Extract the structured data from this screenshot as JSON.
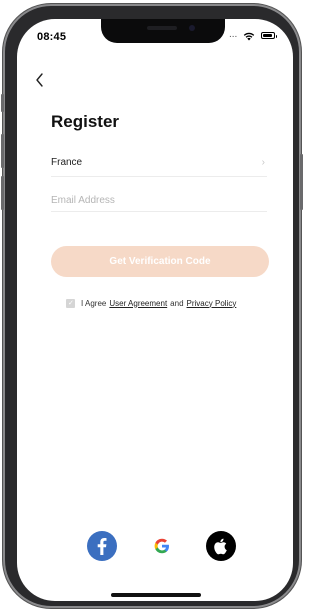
{
  "status_bar": {
    "time": "08:45",
    "signal_text": "...",
    "wifi_icon": "wifi-icon",
    "battery_icon": "battery-icon"
  },
  "nav": {
    "back_icon": "chevron-left-icon"
  },
  "page": {
    "title": "Register"
  },
  "form": {
    "country": "France",
    "country_chevron": "chevron-right-icon",
    "email_placeholder": "Email Address",
    "email_value": "",
    "verify_button": "Get Verification Code"
  },
  "agreement": {
    "checked": true,
    "prefix": "I Agree",
    "user_agreement": "User Agreement",
    "conjunction": "and",
    "privacy_policy": "Privacy Policy"
  },
  "social": {
    "facebook_icon": "facebook-icon",
    "google_icon": "google-icon",
    "apple_icon": "apple-icon"
  },
  "colors": {
    "accent_disabled": "#f6d9c7",
    "facebook_blue": "#3b6fc0",
    "apple_black": "#000000"
  }
}
